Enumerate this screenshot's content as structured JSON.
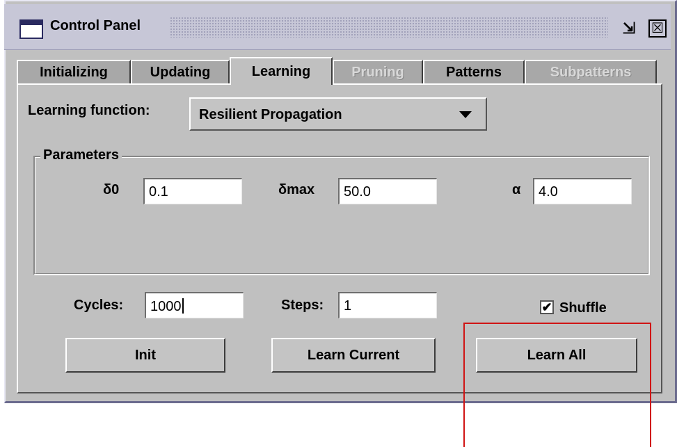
{
  "window": {
    "title": "Control Panel",
    "iconify_glyph": "⇲",
    "close_glyph": "☒"
  },
  "tabs": [
    {
      "label": "Initializing",
      "state": "normal"
    },
    {
      "label": "Updating",
      "state": "normal"
    },
    {
      "label": "Learning",
      "state": "selected"
    },
    {
      "label": "Pruning",
      "state": "disabled"
    },
    {
      "label": "Patterns",
      "state": "normal"
    },
    {
      "label": "Subpatterns",
      "state": "disabled"
    }
  ],
  "learning": {
    "function_label": "Learning function:",
    "function_value": "Resilient Propagation",
    "parameters": {
      "legend": "Parameters",
      "delta0_label": "δ0",
      "delta0_value": "0.1",
      "deltamax_label": "δmax",
      "deltamax_value": "50.0",
      "alpha_label": "α",
      "alpha_value": "4.0"
    },
    "cycles_label": "Cycles:",
    "cycles_value": "1000",
    "steps_label": "Steps:",
    "steps_value": "1",
    "shuffle_label": "Shuffle",
    "shuffle_checked": true,
    "shuffle_check_glyph": "✔"
  },
  "buttons": {
    "init": "Init",
    "learn_current": "Learn Current",
    "learn_all": "Learn All"
  },
  "annotation": {
    "color": "#d01414"
  }
}
